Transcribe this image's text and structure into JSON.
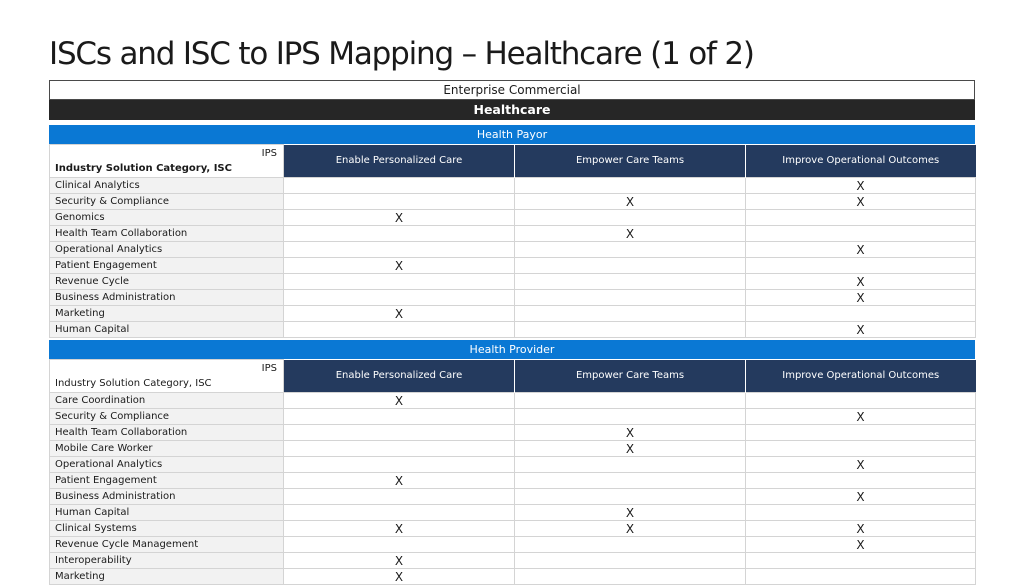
{
  "title": "ISCs and ISC to IPS Mapping – Healthcare (1 of 2)",
  "banner_top": "Enterprise Commercial",
  "banner_industry": "Healthcare",
  "mark": "X",
  "columns": [
    "Enable Personalized Care",
    "Empower Care Teams",
    "Improve Operational Outcomes"
  ],
  "sections": [
    {
      "name": "Health Payor",
      "ips_label": "IPS",
      "isc_label": "Industry Solution Category, ISC",
      "isc_bold": true,
      "rows": [
        {
          "label": "Clinical Analytics",
          "marks": [
            "",
            "",
            "X"
          ]
        },
        {
          "label": "Security & Compliance",
          "marks": [
            "",
            "X",
            "X"
          ]
        },
        {
          "label": "Genomics",
          "marks": [
            "X",
            "",
            ""
          ]
        },
        {
          "label": "Health Team Collaboration",
          "marks": [
            "",
            "X",
            ""
          ]
        },
        {
          "label": "Operational Analytics",
          "marks": [
            "",
            "",
            "X"
          ]
        },
        {
          "label": "Patient Engagement",
          "marks": [
            "X",
            "",
            ""
          ]
        },
        {
          "label": "Revenue Cycle",
          "marks": [
            "",
            "",
            "X"
          ]
        },
        {
          "label": "Business Administration",
          "marks": [
            "",
            "",
            "X"
          ]
        },
        {
          "label": "Marketing",
          "marks": [
            "X",
            "",
            ""
          ]
        },
        {
          "label": "Human Capital",
          "marks": [
            "",
            "",
            "X"
          ]
        }
      ]
    },
    {
      "name": "Health Provider",
      "ips_label": "IPS",
      "isc_label": "Industry Solution Category, ISC",
      "isc_bold": false,
      "rows": [
        {
          "label": "Care Coordination",
          "marks": [
            "X",
            "",
            ""
          ]
        },
        {
          "label": "Security & Compliance",
          "marks": [
            "",
            "",
            "X"
          ]
        },
        {
          "label": "Health Team Collaboration",
          "marks": [
            "",
            "X",
            ""
          ]
        },
        {
          "label": "Mobile Care Worker",
          "marks": [
            "",
            "X",
            ""
          ]
        },
        {
          "label": "Operational Analytics",
          "marks": [
            "",
            "",
            "X"
          ]
        },
        {
          "label": "Patient Engagement",
          "marks": [
            "X",
            "",
            ""
          ]
        },
        {
          "label": "Business Administration",
          "marks": [
            "",
            "",
            "X"
          ]
        },
        {
          "label": "Human Capital",
          "marks": [
            "",
            "X",
            ""
          ]
        },
        {
          "label": "Clinical Systems",
          "marks": [
            "X",
            "X",
            "X"
          ]
        },
        {
          "label": "Revenue Cycle Management",
          "marks": [
            "",
            "",
            "X"
          ]
        },
        {
          "label": "Interoperability",
          "marks": [
            "X",
            "",
            ""
          ]
        },
        {
          "label": "Marketing",
          "marks": [
            "X",
            "",
            ""
          ]
        }
      ]
    }
  ]
}
